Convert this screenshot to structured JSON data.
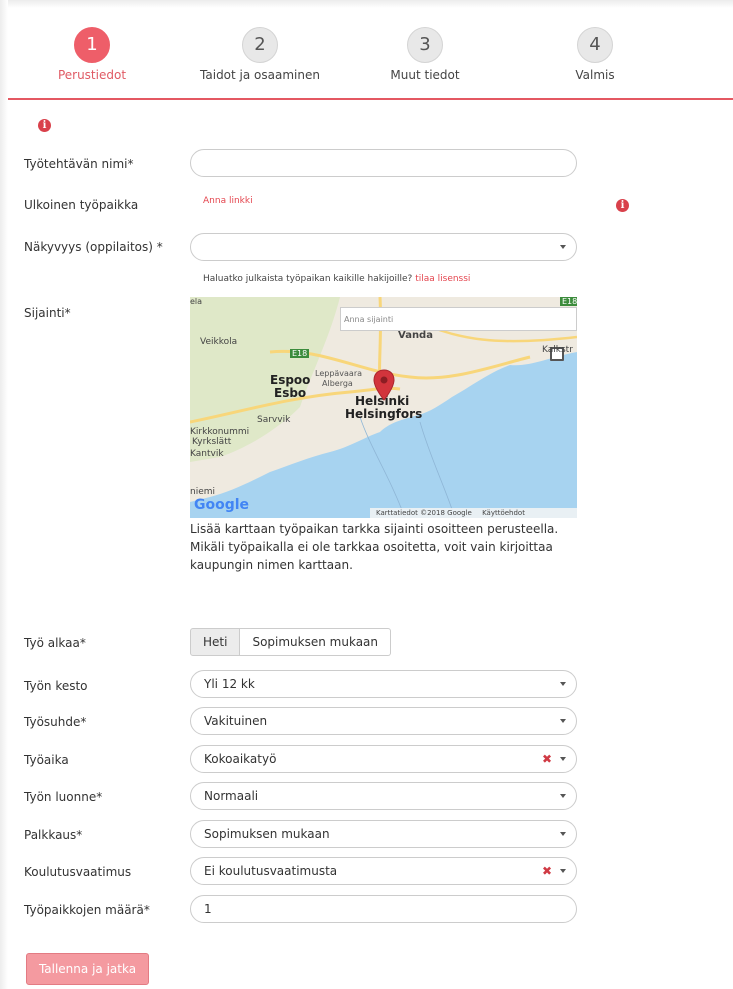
{
  "steps": [
    {
      "number": "1",
      "label": "Perustiedot",
      "active": true
    },
    {
      "number": "2",
      "label": "Taidot ja osaaminen"
    },
    {
      "number": "3",
      "label": "Muut tiedot"
    },
    {
      "number": "4",
      "label": "Valmis"
    }
  ],
  "form": {
    "job_name_label": "Työtehtävän nimi*",
    "job_name_value": "",
    "external_label": "Ulkoinen työpaikka",
    "external_link": "Anna linkki",
    "visibility_label": "Näkyvyys (oppilaitos) *",
    "visibility_value": "",
    "publish_hint": "Haluatko julkaista työpaikan kaikille hakijoille?",
    "publish_link": "tilaa lisenssi",
    "location_label": "Sijainti*",
    "map_search_placeholder": "Anna sijainti",
    "map_description": "Lisää karttaan työpaikan tarkka sijainti osoitteen perusteella. Mikäli työpaikalla ei ole tarkkaa osoitetta, voit vain kirjoittaa kaupungin nimen karttaan.",
    "start_label": "Työ alkaa*",
    "start_options": [
      "Heti",
      "Sopimuksen mukaan"
    ],
    "start_selected": "Heti",
    "duration_label": "Työn kesto",
    "duration_value": "Yli 12 kk",
    "relation_label": "Työsuhde*",
    "relation_value": "Vakituinen",
    "worktime_label": "Työaika",
    "worktime_value": "Kokoaikatyö",
    "nature_label": "Työn luonne*",
    "nature_value": "Normaali",
    "salary_label": "Palkkaus*",
    "salary_value": "Sopimuksen mukaan",
    "education_label": "Koulutusvaatimus",
    "education_value": "Ei koulutusvaatimusta",
    "count_label": "Työpaikkojen määrä*",
    "count_value": "1",
    "save_label": "Tallenna ja jatka"
  },
  "map": {
    "labels": {
      "vantaa": "Vanda",
      "veikkola": "Veikkola",
      "espoo": "Espoo",
      "esbo": "Esbo",
      "leppavaara": "Leppävaara",
      "alberga": "Alberga",
      "helsinki": "Helsinki",
      "helsingfors": "Helsingfors",
      "kalkstrand": "Kalkstr",
      "sarvvik": "Sarvvik",
      "kirkkonummi": "Kirkkonummi",
      "kyrkslatt": "Kyrkslätt",
      "kantvik": "Kantvik",
      "niemi": "niemi",
      "road1": "E18",
      "road2": "E18",
      "ela": "ela"
    },
    "google": "Google",
    "attribution": "Karttatiedot ©2018 Google",
    "terms": "Käyttöehdot",
    "zoom_in": "+",
    "zoom_out": "−"
  },
  "colors": {
    "accent": "#ee5e69",
    "line": "#e45862",
    "save": "#f49aa0"
  }
}
